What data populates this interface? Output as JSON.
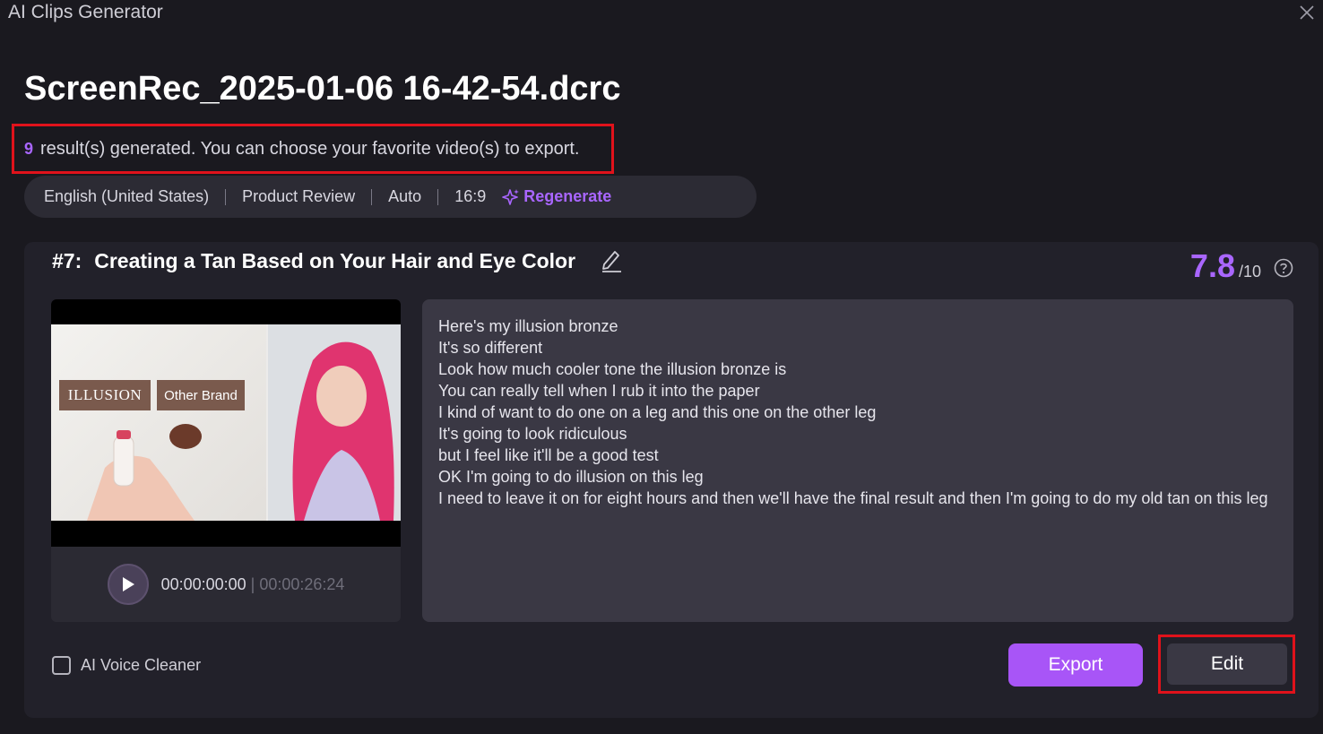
{
  "window": {
    "title": "AI Clips Generator"
  },
  "file": {
    "name": "ScreenRec_2025-01-06 16-42-54.dcrc"
  },
  "results": {
    "count": "9",
    "text": "result(s) generated. You can choose your favorite video(s) to export."
  },
  "settings": {
    "language": "English (United States)",
    "theme": "Product Review",
    "length": "Auto",
    "ratio": "16:9",
    "regenerate_label": "Regenerate"
  },
  "clip": {
    "number": "#7:",
    "title": "Creating a Tan Based on Your Hair and Eye Color",
    "score": "7.8",
    "score_max": "/10",
    "thumbnail": {
      "label_left": "ILLUSION",
      "label_right": "Other Brand"
    },
    "time_current": "00:00:00:00",
    "time_sep": " | ",
    "time_total": "00:00:26:24",
    "transcript": [
      "Here's my illusion bronze",
      "It's so different",
      "Look how much cooler tone the illusion bronze is",
      "You can really tell when I rub it into the paper",
      "I kind of want to do one on a leg and this one on the other leg",
      "It's going to look ridiculous",
      "but I feel like it'll be a good test",
      "OK I'm going to do illusion on this leg",
      "I need to leave it on for eight hours and then we'll have the final result and then I'm going to do my old tan on this leg"
    ]
  },
  "options": {
    "voice_cleaner_label": "AI Voice Cleaner"
  },
  "actions": {
    "export_label": "Export",
    "edit_label": "Edit"
  },
  "colors": {
    "accent": "#a855f7",
    "highlight_box": "#e0121b",
    "background": "#1a191f",
    "card": "#22212a"
  }
}
